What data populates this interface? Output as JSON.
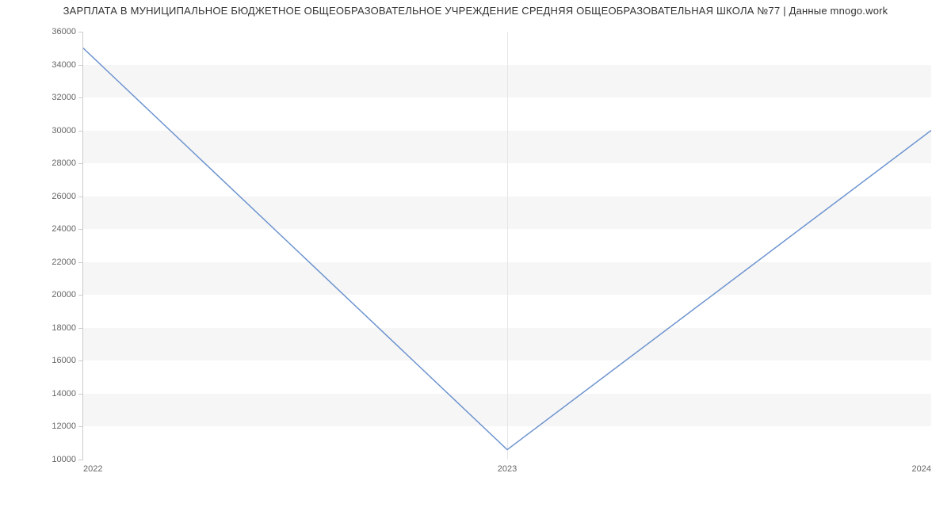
{
  "chart_data": {
    "type": "line",
    "title": "ЗАРПЛАТА В МУНИЦИПАЛЬНОЕ БЮДЖЕТНОЕ ОБЩЕОБРАЗОВАТЕЛЬНОЕ УЧРЕЖДЕНИЕ СРЕДНЯЯ ОБЩЕОБРАЗОВАТЕЛЬНАЯ ШКОЛА №77 | Данные mnogo.work",
    "x": [
      2022,
      2023,
      2024
    ],
    "values": [
      35000,
      10600,
      30000
    ],
    "x_tick_labels": [
      "2022",
      "2023",
      "2024"
    ],
    "y_tick_labels": [
      "10000",
      "12000",
      "14000",
      "16000",
      "18000",
      "20000",
      "22000",
      "24000",
      "26000",
      "28000",
      "30000",
      "32000",
      "34000",
      "36000"
    ],
    "y_tick_values": [
      10000,
      12000,
      14000,
      16000,
      18000,
      20000,
      22000,
      24000,
      26000,
      28000,
      30000,
      32000,
      34000,
      36000
    ],
    "xlabel": "",
    "ylabel": "",
    "ylim": [
      10000,
      36000
    ],
    "xlim": [
      2022,
      2024
    ],
    "line_color": "#6d94cf",
    "grid": true
  }
}
